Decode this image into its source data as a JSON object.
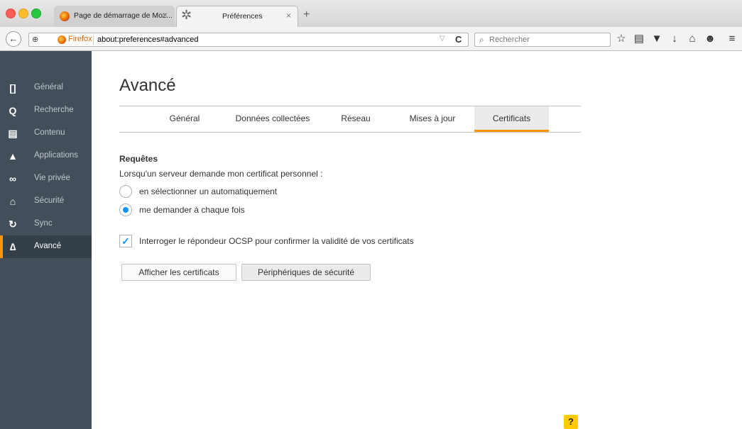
{
  "window": {
    "tabs": [
      {
        "title": "Page de démarrage de Moz...",
        "close": "×"
      },
      {
        "title": "Préférences",
        "close": "×"
      }
    ],
    "new_tab": "+"
  },
  "navbar": {
    "back": "←",
    "identity_label": "Firefox",
    "url": "about:preferences#advanced",
    "url_dropdown": "▽",
    "reload": "C",
    "search_placeholder": "Rechercher",
    "search_icon": "🔍"
  },
  "toolbar_icons": [
    "☆",
    "▤",
    "▼",
    "↓",
    "⌂",
    "☻",
    "≡"
  ],
  "sidebar": {
    "items": [
      {
        "icon": "[]",
        "label": "Général"
      },
      {
        "icon": "Q",
        "label": "Recherche"
      },
      {
        "icon": "▤",
        "label": "Contenu"
      },
      {
        "icon": "▲",
        "label": "Applications"
      },
      {
        "icon": "∞",
        "label": "Vie privée"
      },
      {
        "icon": "⌂",
        "label": "Sécurité"
      },
      {
        "icon": "↻",
        "label": "Sync"
      },
      {
        "icon": "∆",
        "label": "Avancé"
      }
    ],
    "active_index": 7,
    "accent": "#ff9500"
  },
  "main": {
    "title": "Avancé",
    "tabs": [
      "Général",
      "Données collectées",
      "Réseau",
      "Mises à jour",
      "Certificats"
    ],
    "selected_tab": "Certificats",
    "section_title": "Requêtes",
    "section_desc": "Lorsqu'un serveur demande mon certificat personnel :",
    "radios": [
      {
        "label": "en sélectionner un automatiquement",
        "checked": false
      },
      {
        "label": "me demander à chaque fois",
        "checked": true
      }
    ],
    "checkbox": {
      "label": "Interroger le répondeur OCSP pour confirmer la validité de vos certificats",
      "checked": true,
      "mark": "✓"
    },
    "buttons": {
      "view_certs": "Afficher les certificats",
      "security_devices": "Périphériques de sécurité"
    },
    "help": "?"
  }
}
